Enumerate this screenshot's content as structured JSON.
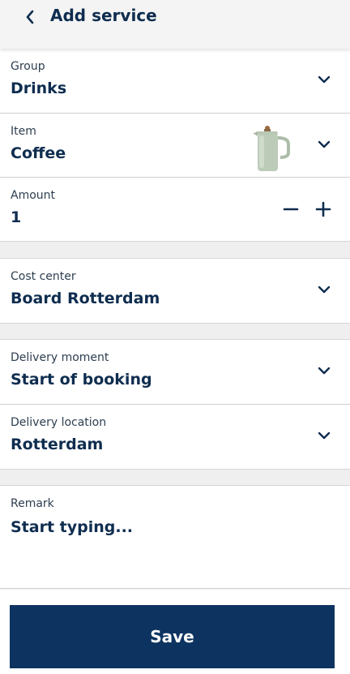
{
  "header": {
    "title": "Add service",
    "back_icon": "chevron-left-icon"
  },
  "colors": {
    "primary": "#0d3461",
    "text": "#0f2d4f",
    "background": "#f2f2f2"
  },
  "form": {
    "group": {
      "label": "Group",
      "value": "Drinks"
    },
    "item": {
      "label": "Item",
      "value": "Coffee",
      "image": "coffee-pot-image"
    },
    "amount": {
      "label": "Amount",
      "value": "1"
    },
    "cost_center": {
      "label": "Cost center",
      "value": "Board Rotterdam"
    },
    "delivery_moment": {
      "label": "Delivery moment",
      "value": "Start of booking"
    },
    "delivery_location": {
      "label": "Delivery location",
      "value": "Rotterdam"
    },
    "remark": {
      "label": "Remark",
      "placeholder": "Start typing..."
    }
  },
  "footer": {
    "save_label": "Save"
  }
}
